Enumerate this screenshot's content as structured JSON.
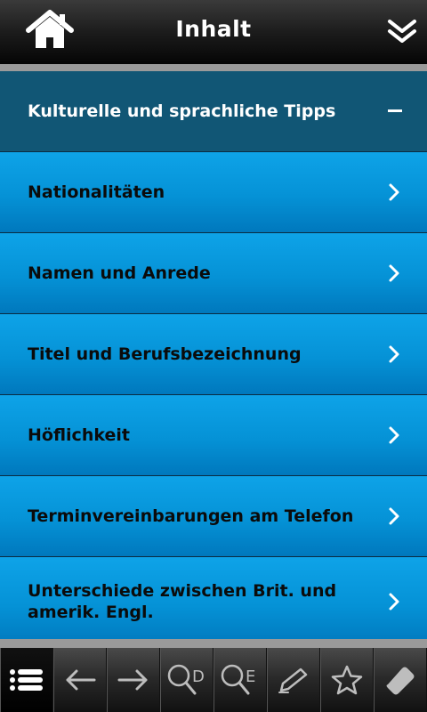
{
  "header": {
    "title": "Inhalt",
    "home_icon": "home-icon",
    "collapse_icon": "double-chevron-down-icon"
  },
  "list": {
    "section": {
      "label": "Kulturelle und sprachliche Tipps",
      "icon": "minus-icon"
    },
    "items": [
      {
        "label": "Nationalitäten"
      },
      {
        "label": "Namen und Anrede"
      },
      {
        "label": "Titel und Berufsbezeichnung"
      },
      {
        "label": "Höflichkeit"
      },
      {
        "label": "Terminvereinbarungen am Telefon"
      },
      {
        "label": "Unterschiede zwischen Brit. und amerik. Engl."
      }
    ]
  },
  "toolbar": {
    "buttons": [
      {
        "icon": "list-icon",
        "active": true
      },
      {
        "icon": "arrow-left-icon"
      },
      {
        "icon": "arrow-right-icon"
      },
      {
        "icon": "search-d-icon",
        "letter": "D"
      },
      {
        "icon": "search-e-icon",
        "letter": "E"
      },
      {
        "icon": "pencil-icon"
      },
      {
        "icon": "star-icon"
      },
      {
        "icon": "eraser-icon"
      }
    ]
  }
}
